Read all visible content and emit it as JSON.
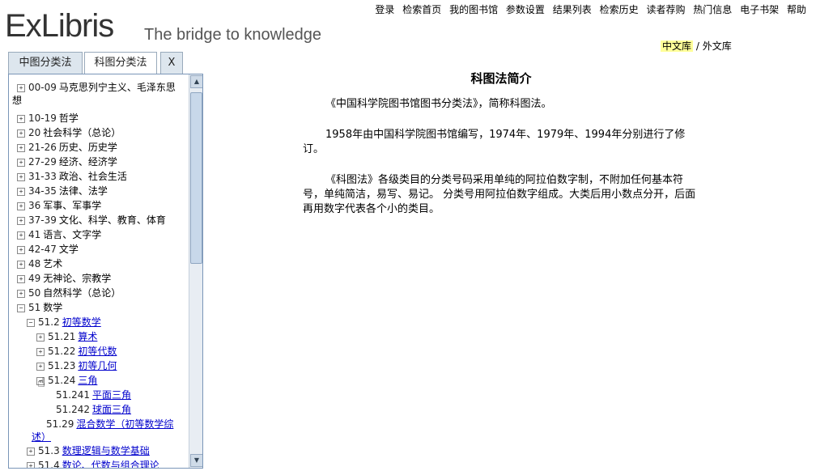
{
  "brand": {
    "name": "ExLibris",
    "tagline": "The bridge to knowledge"
  },
  "topnav": [
    "登录",
    "检索首页",
    "我的图书馆",
    "参数设置",
    "结果列表",
    "检索历史",
    "读者荐购",
    "热门信息",
    "电子书架",
    "帮助"
  ],
  "library": {
    "active": "中文库",
    "separator": "/",
    "other": "外文库"
  },
  "tabs": [
    {
      "label": "中图分类法"
    },
    {
      "label": "科图分类法"
    },
    {
      "label": "X"
    }
  ],
  "tree": [
    {
      "sign": "+",
      "code": "00-09",
      "label": "马克思列宁主义、毛泽东思",
      "label2": "想",
      "level": 0
    },
    {
      "sign": "+",
      "code": "10-19",
      "label": "哲学",
      "level": 0
    },
    {
      "sign": "+",
      "code": "20",
      "label": "社会科学（总论）",
      "level": 0
    },
    {
      "sign": "+",
      "code": "21-26",
      "label": "历史、历史学",
      "level": 0
    },
    {
      "sign": "+",
      "code": "27-29",
      "label": "经济、经济学",
      "level": 0
    },
    {
      "sign": "+",
      "code": "31-33",
      "label": "政治、社会生活",
      "level": 0
    },
    {
      "sign": "+",
      "code": "34-35",
      "label": "法律、法学",
      "level": 0
    },
    {
      "sign": "+",
      "code": "36",
      "label": "军事、军事学",
      "level": 0
    },
    {
      "sign": "+",
      "code": "37-39",
      "label": "文化、科学、教育、体育",
      "level": 0
    },
    {
      "sign": "+",
      "code": "41",
      "label": "语言、文字学",
      "level": 0
    },
    {
      "sign": "+",
      "code": "42-47",
      "label": "文学",
      "level": 0
    },
    {
      "sign": "+",
      "code": "48",
      "label": "艺术",
      "level": 0
    },
    {
      "sign": "+",
      "code": "49",
      "label": "无神论、宗教学",
      "level": 0
    },
    {
      "sign": "+",
      "code": "50",
      "label": "自然科学（总论）",
      "level": 0
    },
    {
      "sign": "−",
      "code": "51",
      "label": "数学",
      "level": 0
    },
    {
      "sign": "−",
      "code": "51.2",
      "label": "初等数学",
      "level": 1,
      "link": true
    },
    {
      "sign": "+",
      "code": "51.21",
      "label": "算术",
      "level": 2,
      "link": true
    },
    {
      "sign": "+",
      "code": "51.22",
      "label": "初等代数",
      "level": 2,
      "link": true
    },
    {
      "sign": "+",
      "code": "51.23",
      "label": "初等几何",
      "level": 2,
      "link": true
    },
    {
      "sign": "−",
      "code": "51.24",
      "label": "三角",
      "level": 2,
      "link": true
    },
    {
      "sign": "",
      "code": "51.241",
      "label": "平面三角",
      "level": 3,
      "link": true
    },
    {
      "sign": "",
      "code": "51.242",
      "label": "球面三角",
      "level": 3,
      "link": true
    },
    {
      "sign": "",
      "code": "51.29",
      "label": "混合数学（初等数学综",
      "label2": "述）",
      "level": 2,
      "link": true
    },
    {
      "sign": "+",
      "code": "51.3",
      "label": "数理逻辑与数学基础",
      "level": 1,
      "link": true
    },
    {
      "sign": "+",
      "code": "51.4",
      "label": "数论、代数与组合理论",
      "level": 1,
      "link": true
    }
  ],
  "content": {
    "title": "科图法简介",
    "paragraphs": [
      "《中国科学院图书馆图书分类法》，简称科图法。",
      "1958年由中国科学院图书馆编写，1974年、1979年、1994年分别进行了修订。",
      "《科图法》各级类目的分类号码采用单纯的阿拉伯数字制，不附加任何基本符号，单纯简洁，易写、易记。 分类号用阿拉伯数字组成。大类后用小数点分开，后面再用数字代表各个小的类目。"
    ]
  },
  "icons": {
    "expand": "plus-box-icon",
    "collapse": "minus-box-icon",
    "cursor": "hand-pointer-icon"
  }
}
